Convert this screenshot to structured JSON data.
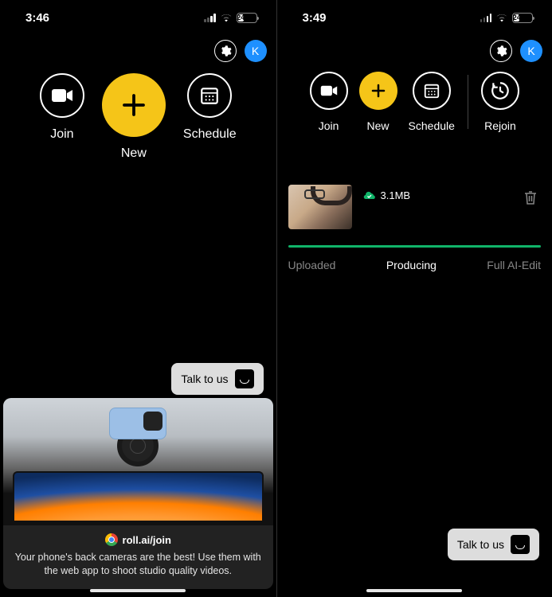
{
  "left": {
    "status": {
      "time": "3:46",
      "battery_pct": "24"
    },
    "avatar_initial": "K",
    "actions": {
      "join": "Join",
      "new": "New",
      "schedule": "Schedule"
    },
    "talk_to_us": "Talk to us",
    "promo": {
      "url": "roll.ai/join",
      "text": "Your phone's back cameras are the best! Use them with the web app to shoot studio quality videos."
    }
  },
  "right": {
    "status": {
      "time": "3:49",
      "battery_pct": "24"
    },
    "avatar_initial": "K",
    "actions": {
      "join": "Join",
      "new": "New",
      "schedule": "Schedule",
      "rejoin": "Rejoin"
    },
    "upload": {
      "size": "3.1MB"
    },
    "stages": {
      "uploaded": "Uploaded",
      "producing": "Producing",
      "full_ai_edit": "Full AI-Edit"
    },
    "talk_to_us": "Talk to us"
  }
}
